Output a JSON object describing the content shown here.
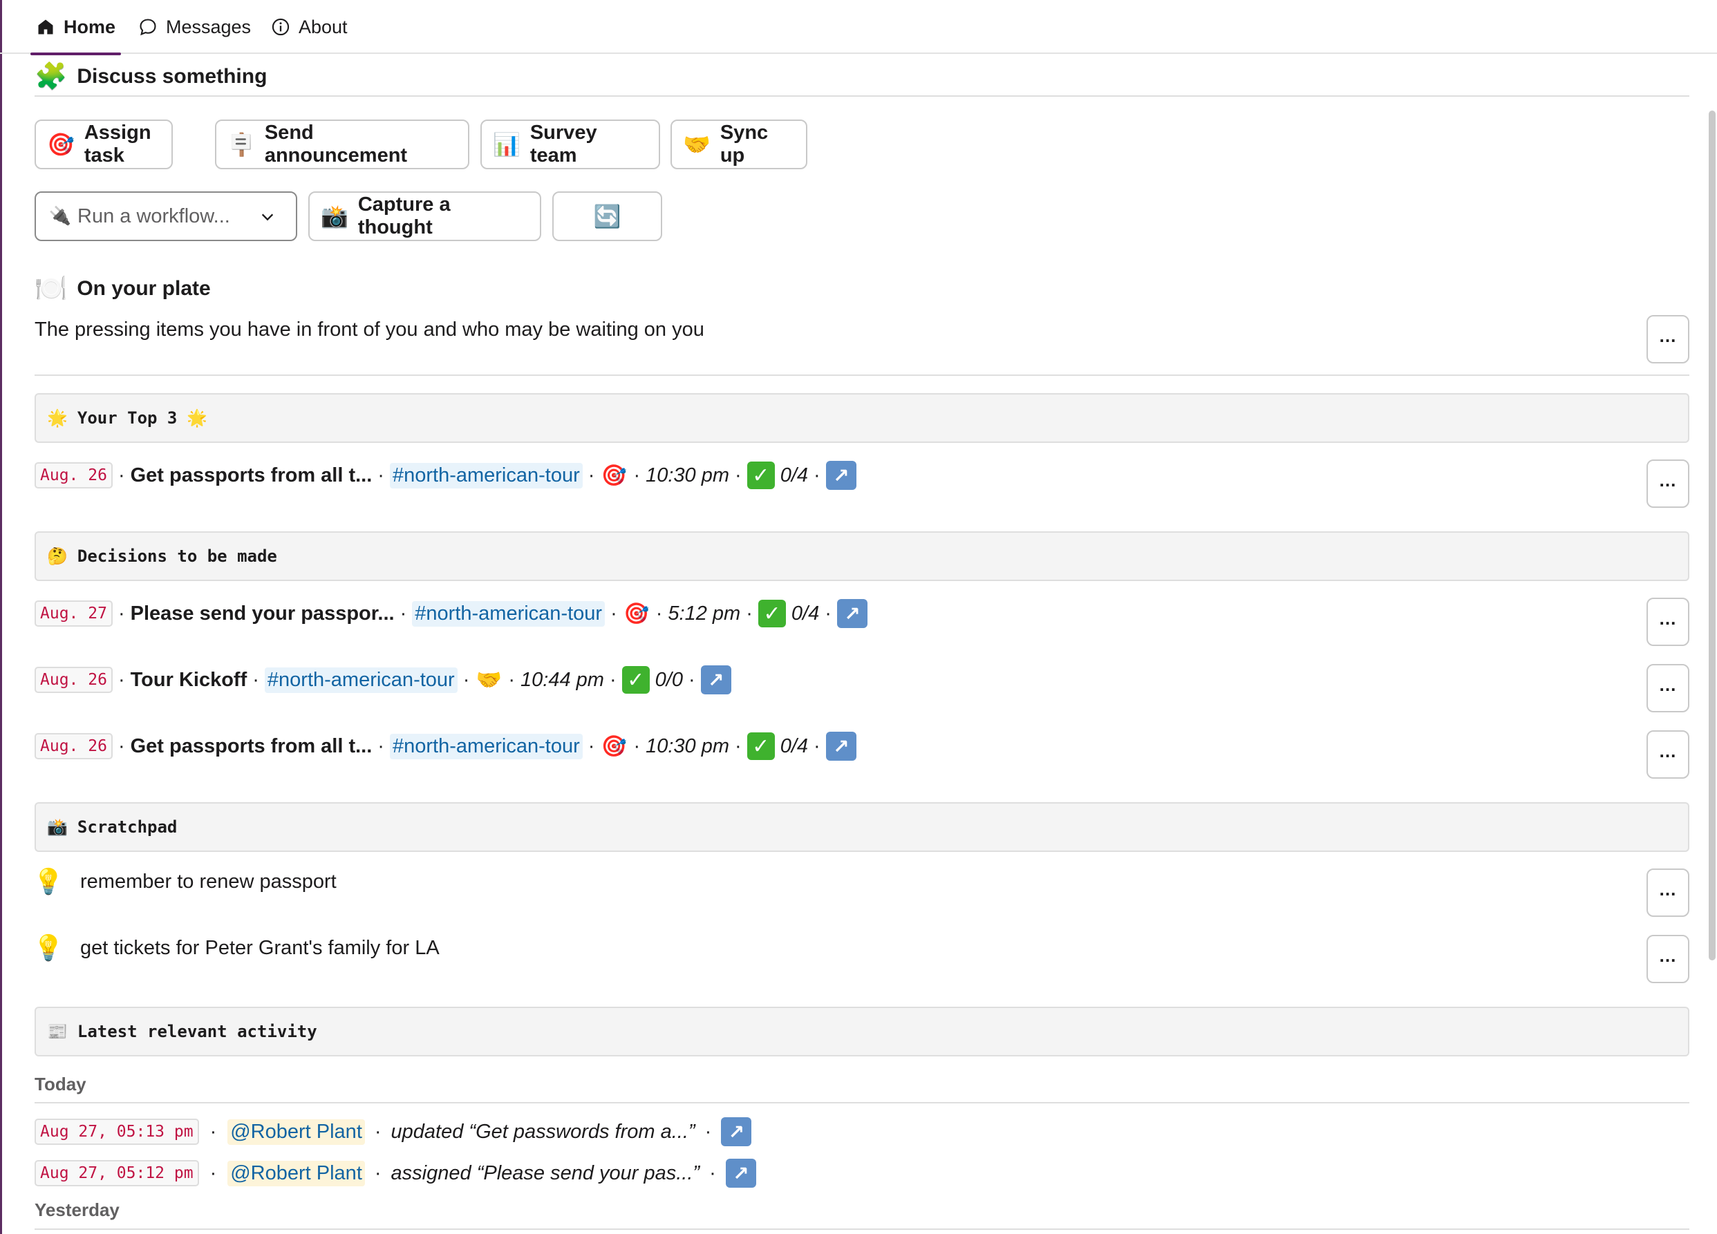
{
  "tabs": [
    {
      "label": "Home",
      "icon": "home-icon",
      "active": true
    },
    {
      "label": "Messages",
      "icon": "message-bubble-icon",
      "active": false
    },
    {
      "label": "About",
      "icon": "info-icon",
      "active": false
    }
  ],
  "discuss": {
    "icon": "🧩",
    "title": "Discuss something",
    "buttons": [
      {
        "icon": "🎯",
        "label": "Assign task"
      },
      {
        "icon": "🪧",
        "label": "Send announcement"
      },
      {
        "icon": "📊",
        "label": "Survey team"
      },
      {
        "icon": "🤝",
        "label": "Sync up"
      }
    ],
    "workflow_select": {
      "icon": "🔌",
      "placeholder": "Run a workflow..."
    },
    "capture": {
      "icon": "📸",
      "label": "Capture a thought"
    },
    "refresh_icon": "🔄"
  },
  "plate": {
    "icon": "🍽️",
    "title": "On your plate",
    "description": "The pressing items you have in front of you and who may be waiting on you"
  },
  "top3": {
    "icon_left": "🌟",
    "icon_right": "🌟",
    "title": "Your Top 3",
    "items": [
      {
        "date": "Aug. 26",
        "title": "Get passports from all t...",
        "channel": "#north-american-tour",
        "icon": "🎯",
        "time": "10:30 pm",
        "progress": "0/4"
      }
    ]
  },
  "decisions": {
    "icon": "🤔",
    "title": "Decisions to be made",
    "items": [
      {
        "date": "Aug. 27",
        "title": "Please send your passpor...",
        "channel": "#north-american-tour",
        "icon": "🎯",
        "time": "5:12 pm",
        "progress": "0/4"
      },
      {
        "date": "Aug. 26",
        "title": "Tour Kickoff",
        "channel": "#north-american-tour",
        "icon": "🤝",
        "time": "10:44 pm",
        "progress": "0/0"
      },
      {
        "date": "Aug. 26",
        "title": "Get passports from all t...",
        "channel": "#north-american-tour",
        "icon": "🎯",
        "time": "10:30 pm",
        "progress": "0/4"
      }
    ]
  },
  "scratchpad": {
    "icon": "📸",
    "title": "Scratchpad",
    "notes": [
      {
        "icon": "💡",
        "text": "remember to renew passport"
      },
      {
        "icon": "💡",
        "text": "get tickets for Peter Grant's family for LA"
      }
    ]
  },
  "activity": {
    "icon": "📰",
    "title": "Latest relevant activity",
    "today_label": "Today",
    "yesterday_label": "Yesterday",
    "items": [
      {
        "timestamp": "Aug 27, 05:13 pm",
        "user": "@Robert Plant",
        "action": "updated “Get passwords from a...”"
      },
      {
        "timestamp": "Aug 27, 05:12 pm",
        "user": "@Robert Plant",
        "action": "assigned “Please send your pas...”"
      }
    ]
  },
  "more_label": "…",
  "check_glyph": "✓",
  "arrow_glyph": "↗",
  "separator": "·"
}
